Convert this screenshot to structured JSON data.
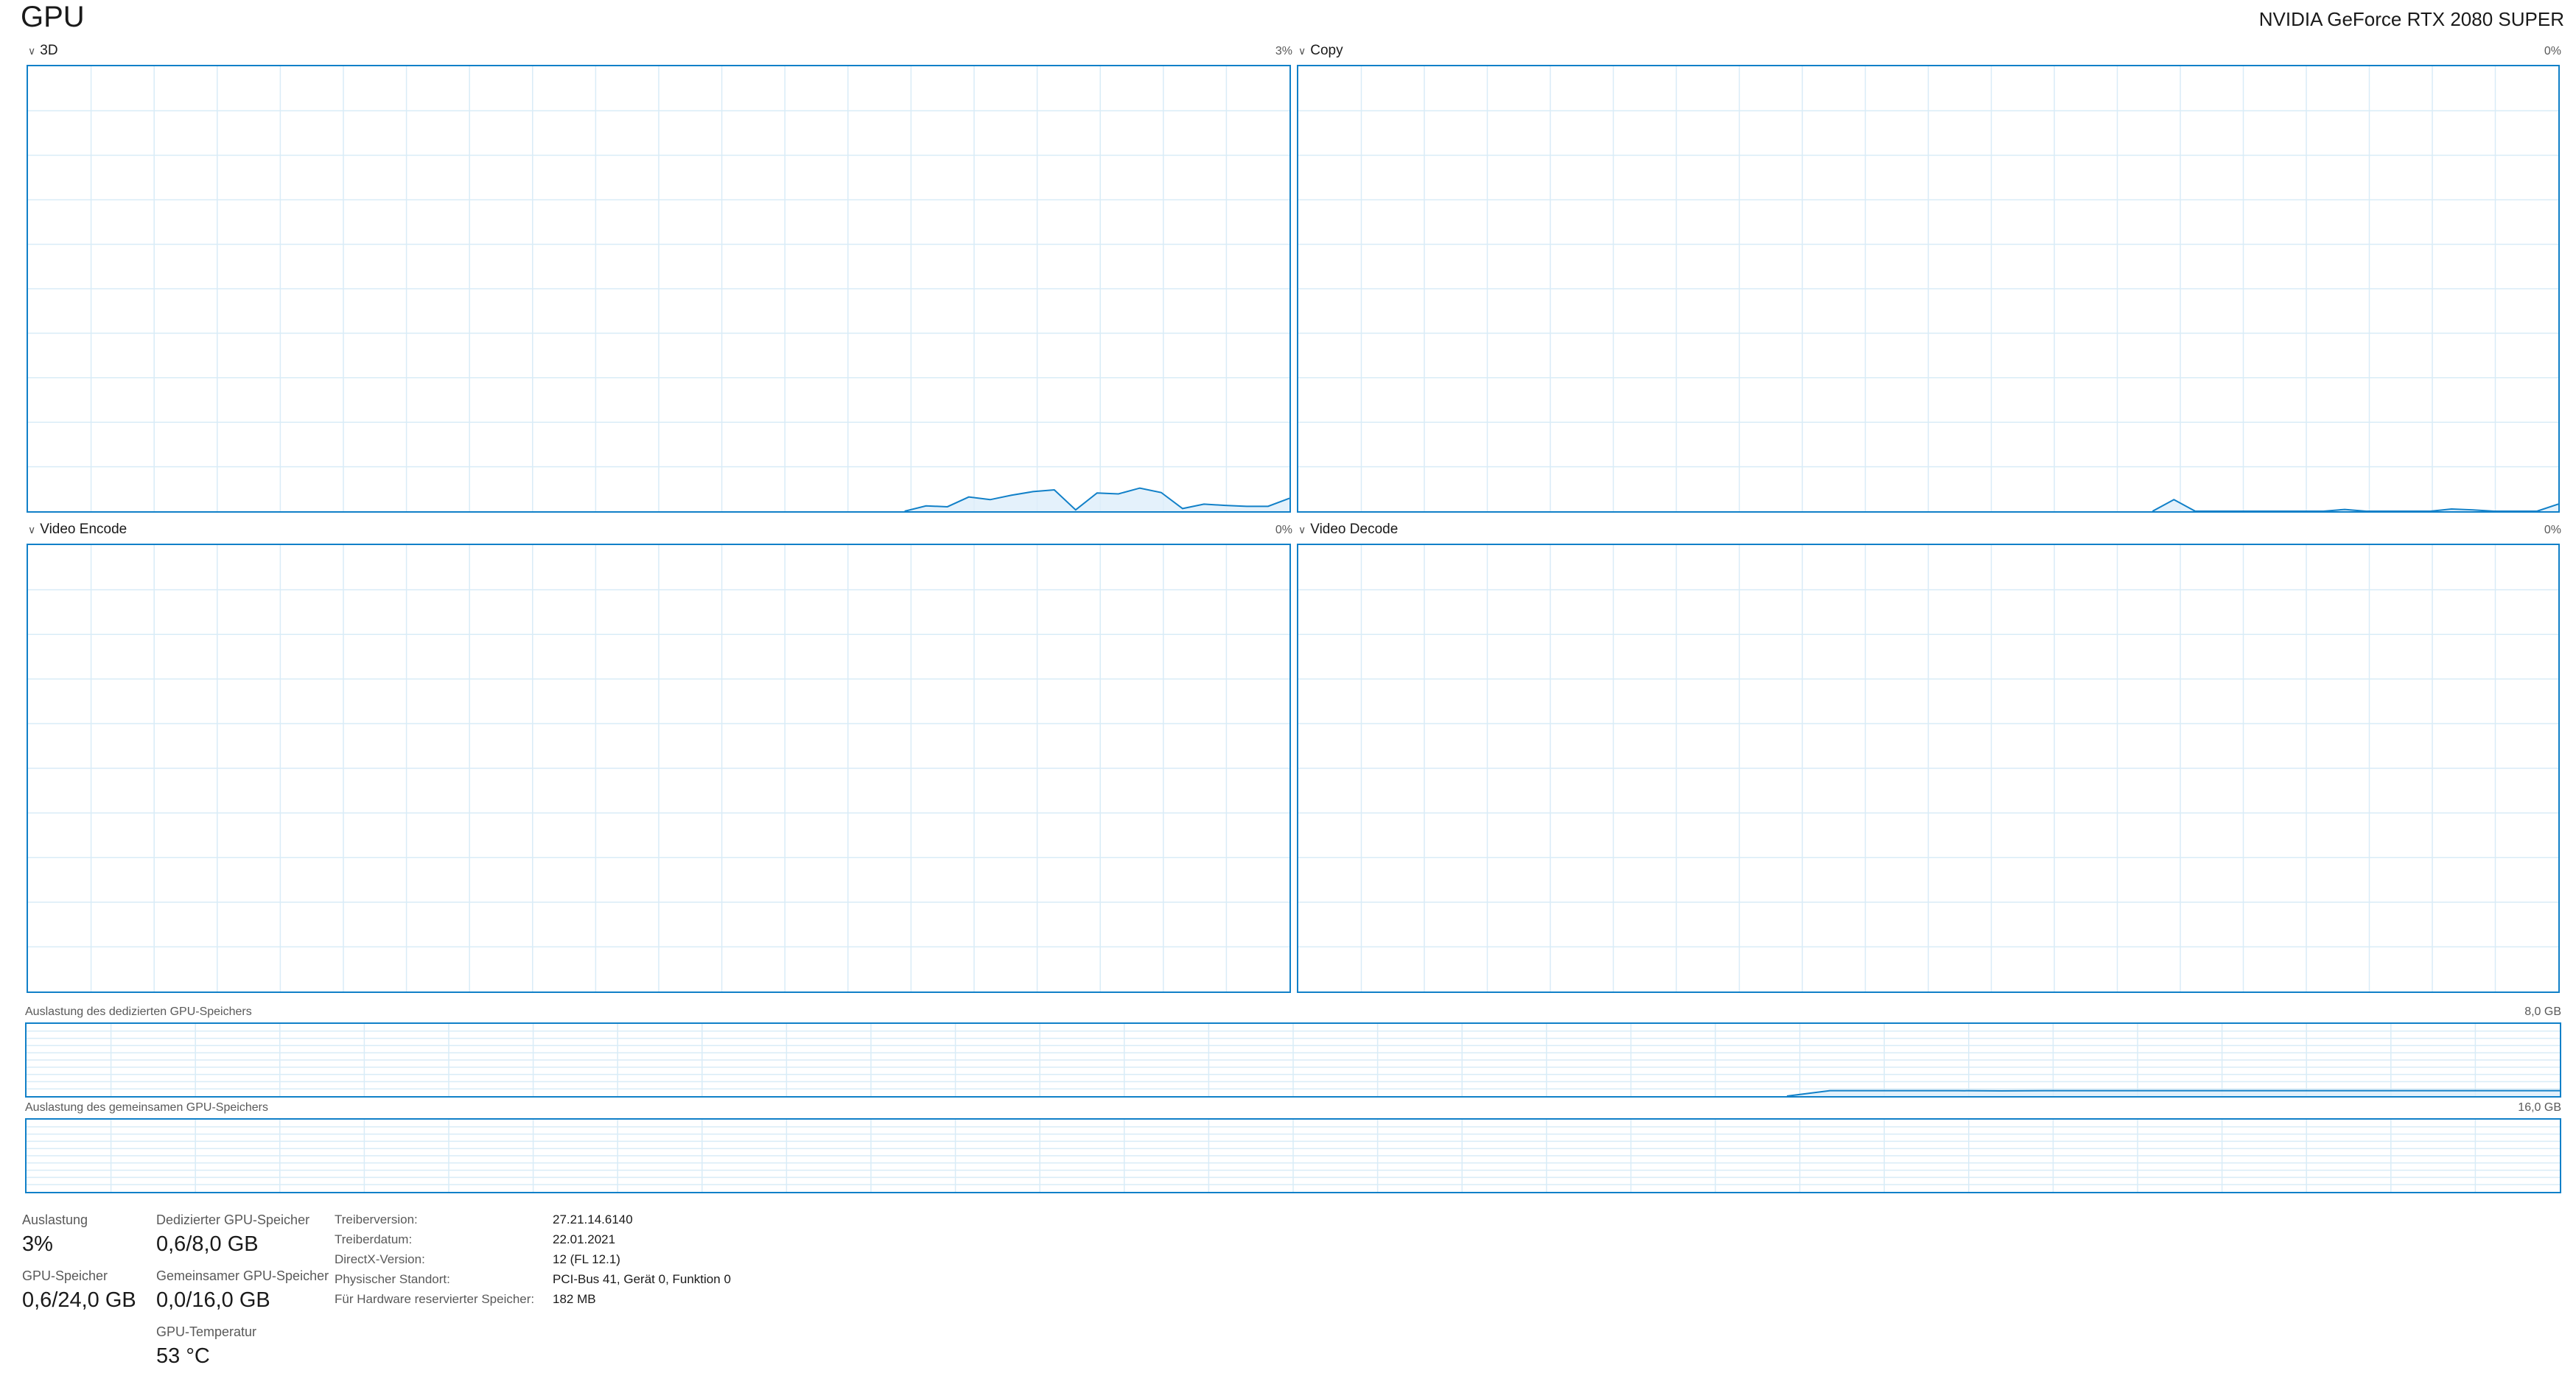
{
  "header": {
    "title": "GPU",
    "device_name": "NVIDIA GeForce RTX 2080 SUPER"
  },
  "colors": {
    "accent": "#1180c8",
    "grid": "#d9ecf7",
    "fill": "#ddeefa"
  },
  "panels": [
    {
      "label": "3D",
      "value": "3%",
      "icon": "chevron-down-icon"
    },
    {
      "label": "Copy",
      "value": "0%",
      "icon": "chevron-down-icon"
    },
    {
      "label": "Video Encode",
      "value": "0%",
      "icon": "chevron-down-icon"
    },
    {
      "label": "Video Decode",
      "value": "0%",
      "icon": "chevron-down-icon"
    }
  ],
  "memory": {
    "dedicated": {
      "label": "Auslastung des dedizierten GPU-Speichers",
      "max": "8,0 GB"
    },
    "shared": {
      "label": "Auslastung des gemeinsamen GPU-Speichers",
      "max": "16,0 GB"
    }
  },
  "stats": {
    "usage": {
      "label": "Auslastung",
      "value": "3%"
    },
    "gpu_memory": {
      "label": "GPU-Speicher",
      "value": "0,6/24,0 GB"
    },
    "dedicated_memory": {
      "label": "Dedizierter GPU-Speicher",
      "value": "0,6/8,0 GB"
    },
    "shared_memory": {
      "label": "Gemeinsamer GPU-Speicher",
      "value": "0,0/16,0 GB"
    },
    "temperature": {
      "label": "GPU-Temperatur",
      "value": "53 °C"
    }
  },
  "info": [
    {
      "key": "Treiberversion:",
      "value": "27.21.14.6140"
    },
    {
      "key": "Treiberdatum:",
      "value": "22.01.2021"
    },
    {
      "key": "DirectX-Version:",
      "value": "12 (FL 12.1)"
    },
    {
      "key": "Physischer Standort:",
      "value": "PCI-Bus 41, Gerät 0, Funktion 0"
    },
    {
      "key": "Für Hardware reservierter Speicher:",
      "value": "182 MB"
    }
  ],
  "chart_data": [
    {
      "type": "area",
      "name": "3D",
      "x": [
        0,
        1,
        2,
        3,
        4,
        5,
        6,
        7,
        8,
        9,
        10,
        11,
        12,
        13,
        14,
        15,
        16,
        17,
        18,
        19,
        20,
        21,
        22,
        23,
        24,
        25,
        26,
        27,
        28,
        29,
        30,
        31,
        32,
        33,
        34,
        35,
        36,
        37,
        38,
        39,
        40,
        41,
        42,
        43,
        44,
        45,
        46,
        47,
        48,
        49,
        50,
        51,
        52,
        53,
        54,
        55,
        56,
        57,
        58,
        59
      ],
      "values": [
        0,
        0,
        0,
        0,
        0,
        0,
        0,
        0,
        0,
        0,
        0,
        0,
        0,
        0,
        0,
        0,
        0,
        0,
        0,
        0,
        0,
        0,
        0,
        0,
        0,
        0,
        0,
        0,
        0,
        0,
        0,
        0,
        0,
        0,
        0,
        0,
        0,
        0,
        0,
        0,
        0,
        0,
        1.2,
        1.0,
        3.2,
        2.6,
        3.6,
        4.4,
        4.8,
        0.3,
        4.1,
        3.9,
        5.2,
        4.2,
        0.6,
        1.6,
        1.3,
        1.1,
        1.1,
        2.9
      ],
      "ylim": [
        0,
        100
      ]
    },
    {
      "type": "area",
      "name": "Copy",
      "x": [
        0,
        1,
        2,
        3,
        4,
        5,
        6,
        7,
        8,
        9,
        10,
        11,
        12,
        13,
        14,
        15,
        16,
        17,
        18,
        19,
        20,
        21,
        22,
        23,
        24,
        25,
        26,
        27,
        28,
        29,
        30,
        31,
        32,
        33,
        34,
        35,
        36,
        37,
        38,
        39,
        40,
        41,
        42,
        43,
        44,
        45,
        46,
        47,
        48,
        49,
        50,
        51,
        52,
        53,
        54,
        55,
        56,
        57,
        58,
        59
      ],
      "values": [
        0,
        0,
        0,
        0,
        0,
        0,
        0,
        0,
        0,
        0,
        0,
        0,
        0,
        0,
        0,
        0,
        0,
        0,
        0,
        0,
        0,
        0,
        0,
        0,
        0,
        0,
        0,
        0,
        0,
        0,
        0,
        0,
        0,
        0,
        0,
        0,
        0,
        0,
        0,
        0,
        0,
        2.6,
        0,
        0,
        0,
        0,
        0,
        0,
        0,
        0.4,
        0,
        0,
        0,
        0,
        0.5,
        0.3,
        0,
        0,
        0,
        1.6
      ],
      "ylim": [
        0,
        100
      ]
    },
    {
      "type": "area",
      "name": "Video Encode",
      "x": [
        0,
        59
      ],
      "values": [
        0,
        0
      ],
      "ylim": [
        0,
        100
      ]
    },
    {
      "type": "area",
      "name": "Video Decode",
      "x": [
        0,
        59
      ],
      "values": [
        0,
        0
      ],
      "ylim": [
        0,
        100
      ]
    },
    {
      "type": "area",
      "name": "Auslastung des dedizierten GPU-Speichers",
      "x": [
        0,
        1,
        2,
        3,
        4,
        5,
        6,
        7,
        8,
        9,
        10,
        11,
        12,
        13,
        14,
        15,
        16,
        17,
        18,
        19,
        20,
        21,
        22,
        23,
        24,
        25,
        26,
        27,
        28,
        29,
        30,
        31,
        32,
        33,
        34,
        35,
        36,
        37,
        38,
        39,
        40,
        41,
        42,
        43,
        44,
        45,
        46,
        47,
        48,
        49,
        50,
        51,
        52,
        53,
        54,
        55,
        56,
        57,
        58,
        59
      ],
      "values": [
        0,
        0,
        0,
        0,
        0,
        0,
        0,
        0,
        0,
        0,
        0,
        0,
        0,
        0,
        0,
        0,
        0,
        0,
        0,
        0,
        0,
        0,
        0,
        0,
        0,
        0,
        0,
        0,
        0,
        0,
        0,
        0,
        0,
        0,
        0,
        0,
        0,
        0,
        0,
        0,
        0,
        0,
        0.6,
        0.6,
        0.6,
        0.6,
        0.58,
        0.6,
        0.6,
        0.6,
        0.6,
        0.6,
        0.6,
        0.6,
        0.6,
        0.6,
        0.6,
        0.6,
        0.6,
        0.6
      ],
      "ylim": [
        0,
        8
      ]
    },
    {
      "type": "area",
      "name": "Auslastung des gemeinsamen GPU-Speichers",
      "x": [
        0,
        59
      ],
      "values": [
        0,
        0
      ],
      "ylim": [
        0,
        16
      ]
    }
  ]
}
